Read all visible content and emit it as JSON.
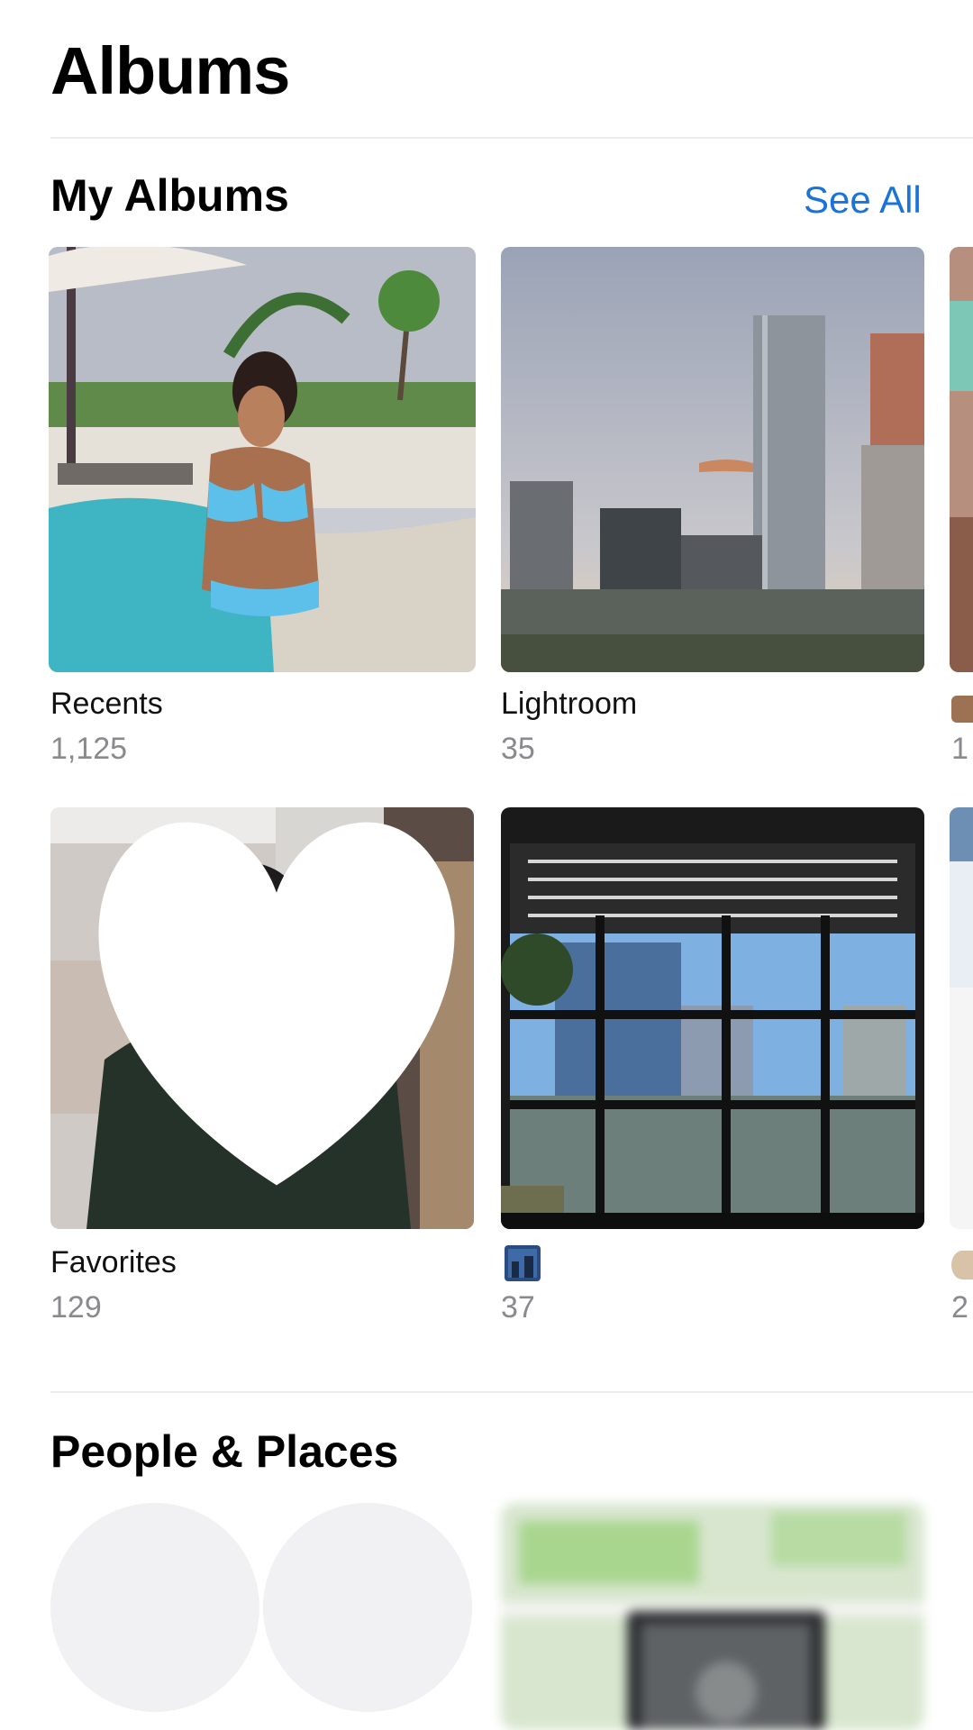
{
  "header": {
    "title": "Albums"
  },
  "my_albums": {
    "section_title": "My Albums",
    "see_all_label": "See All",
    "albums": [
      {
        "label": "Recents",
        "count": "1,125"
      },
      {
        "label": "Lightroom",
        "count": "35"
      },
      {
        "label": "Favorites",
        "count": "129"
      },
      {
        "label": "",
        "count": "37"
      }
    ],
    "partial_counts": [
      "1",
      "2"
    ]
  },
  "people_places": {
    "section_title": "People & Places"
  },
  "colors": {
    "accent": "#1a73d9",
    "secondary_text": "#8a8a8e",
    "divider": "#ececec"
  }
}
